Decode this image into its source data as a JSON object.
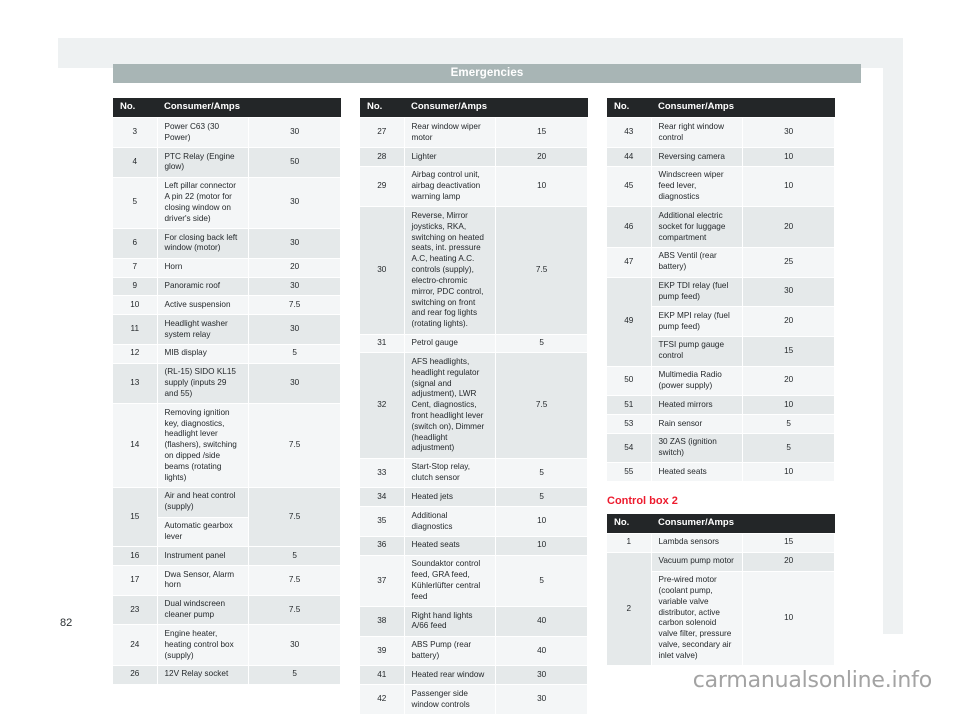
{
  "page": {
    "header_title": "Emergencies",
    "page_number": "82",
    "watermark": "carmanualsonline.info"
  },
  "table_headers": {
    "no": "No.",
    "consumer": "Consumer/Amps"
  },
  "sections": [
    {
      "id": "control-box-1-col-1",
      "heading": null,
      "rows": [
        {
          "no": "3",
          "lines": [
            {
              "desc": "Power C63 (30 Power)",
              "amp": "30"
            }
          ]
        },
        {
          "no": "4",
          "lines": [
            {
              "desc": "PTC Relay (Engine glow)",
              "amp": "50"
            }
          ]
        },
        {
          "no": "5",
          "lines": [
            {
              "desc": "Left pillar connector A pin 22 (motor for closing window on driver's side)",
              "amp": "30"
            }
          ]
        },
        {
          "no": "6",
          "lines": [
            {
              "desc": "For closing back left window (motor)",
              "amp": "30"
            }
          ]
        },
        {
          "no": "7",
          "lines": [
            {
              "desc": "Horn",
              "amp": "20"
            }
          ]
        },
        {
          "no": "9",
          "lines": [
            {
              "desc": "Panoramic roof",
              "amp": "30"
            }
          ]
        },
        {
          "no": "10",
          "lines": [
            {
              "desc": "Active suspension",
              "amp": "7.5"
            }
          ]
        },
        {
          "no": "11",
          "lines": [
            {
              "desc": "Headlight washer system relay",
              "amp": "30"
            }
          ]
        },
        {
          "no": "12",
          "lines": [
            {
              "desc": "MIB display",
              "amp": "5"
            }
          ]
        },
        {
          "no": "13",
          "lines": [
            {
              "desc": "(RL-15) SIDO KL15 supply (inputs 29 and 55)",
              "amp": "30"
            }
          ]
        },
        {
          "no": "14",
          "lines": [
            {
              "desc": "Removing ignition key, diagnostics, headlight lever (flashers), switching on dipped /side beams (rotating lights)",
              "amp": "7.5"
            }
          ]
        },
        {
          "no": "15",
          "merged_amp": "7.5",
          "lines": [
            {
              "desc": "Air and heat control (supply)"
            },
            {
              "desc": "Automatic gearbox lever"
            }
          ]
        },
        {
          "no": "16",
          "lines": [
            {
              "desc": "Instrument panel",
              "amp": "5"
            }
          ]
        },
        {
          "no": "17",
          "lines": [
            {
              "desc": "Dwa Sensor, Alarm horn",
              "amp": "7.5"
            }
          ]
        },
        {
          "no": "23",
          "lines": [
            {
              "desc": "Dual windscreen cleaner pump",
              "amp": "7.5"
            }
          ]
        },
        {
          "no": "24",
          "lines": [
            {
              "desc": "Engine heater, heating control box (supply)",
              "amp": "30"
            }
          ]
        },
        {
          "no": "26",
          "lines": [
            {
              "desc": "12V Relay socket",
              "amp": "5"
            }
          ]
        }
      ]
    },
    {
      "id": "control-box-1-col-2",
      "heading": null,
      "rows": [
        {
          "no": "27",
          "lines": [
            {
              "desc": "Rear window wiper motor",
              "amp": "15"
            }
          ]
        },
        {
          "no": "28",
          "lines": [
            {
              "desc": "Lighter",
              "amp": "20"
            }
          ]
        },
        {
          "no": "29",
          "lines": [
            {
              "desc": "Airbag control unit, airbag deactivation warning lamp",
              "amp": "10"
            }
          ]
        },
        {
          "no": "30",
          "lines": [
            {
              "desc": "Reverse, Mirror joysticks, RKA, switching on heated seats, int. pressure A.C, heating A.C. controls (supply), electro-chromic mirror, PDC control, switching on front and rear fog lights (rotating lights).",
              "amp": "7.5"
            }
          ]
        },
        {
          "no": "31",
          "lines": [
            {
              "desc": "Petrol gauge",
              "amp": "5"
            }
          ]
        },
        {
          "no": "32",
          "lines": [
            {
              "desc": "AFS headlights, headlight regulator (signal and adjustment), LWR Cent, diagnostics, front headlight lever (switch on), Dimmer (headlight adjustment)",
              "amp": "7.5"
            }
          ]
        },
        {
          "no": "33",
          "lines": [
            {
              "desc": "Start-Stop relay, clutch sensor",
              "amp": "5"
            }
          ]
        },
        {
          "no": "34",
          "lines": [
            {
              "desc": "Heated jets",
              "amp": "5"
            }
          ]
        },
        {
          "no": "35",
          "lines": [
            {
              "desc": "Additional diagnostics",
              "amp": "10"
            }
          ]
        },
        {
          "no": "36",
          "lines": [
            {
              "desc": "Heated seats",
              "amp": "10"
            }
          ]
        },
        {
          "no": "37",
          "lines": [
            {
              "desc": "Soundaktor control feed, GRA feed, Kühlerlüfter central feed",
              "amp": "5"
            }
          ]
        },
        {
          "no": "38",
          "lines": [
            {
              "desc": "Right hand lights A/66 feed",
              "amp": "40"
            }
          ]
        },
        {
          "no": "39",
          "lines": [
            {
              "desc": "ABS Pump (rear battery)",
              "amp": "40"
            }
          ]
        },
        {
          "no": "41",
          "lines": [
            {
              "desc": "Heated rear window",
              "amp": "30"
            }
          ]
        },
        {
          "no": "42",
          "lines": [
            {
              "desc": "Passenger side window controls",
              "amp": "30"
            }
          ]
        }
      ]
    },
    {
      "id": "control-box-1-col-3",
      "heading": null,
      "rows": [
        {
          "no": "43",
          "lines": [
            {
              "desc": "Rear right window control",
              "amp": "30"
            }
          ]
        },
        {
          "no": "44",
          "lines": [
            {
              "desc": "Reversing camera",
              "amp": "10"
            }
          ]
        },
        {
          "no": "45",
          "lines": [
            {
              "desc": "Windscreen wiper feed lever, diagnostics",
              "amp": "10"
            }
          ]
        },
        {
          "no": "46",
          "lines": [
            {
              "desc": "Additional electric socket for luggage compartment",
              "amp": "20"
            }
          ]
        },
        {
          "no": "47",
          "lines": [
            {
              "desc": "ABS Ventil (rear battery)",
              "amp": "25"
            }
          ]
        },
        {
          "no": "49",
          "lines": [
            {
              "desc": "EKP TDI relay (fuel pump feed)",
              "amp": "30"
            },
            {
              "desc": "EKP MPI relay (fuel pump feed)",
              "amp": "20"
            },
            {
              "desc": "TFSI pump gauge control",
              "amp": "15"
            }
          ]
        },
        {
          "no": "50",
          "lines": [
            {
              "desc": "Multimedia Radio (power supply)",
              "amp": "20"
            }
          ]
        },
        {
          "no": "51",
          "lines": [
            {
              "desc": "Heated mirrors",
              "amp": "10"
            }
          ]
        },
        {
          "no": "53",
          "lines": [
            {
              "desc": "Rain sensor",
              "amp": "5"
            }
          ]
        },
        {
          "no": "54",
          "lines": [
            {
              "desc": "30 ZAS (ignition switch)",
              "amp": "5"
            }
          ]
        },
        {
          "no": "55",
          "lines": [
            {
              "desc": "Heated seats",
              "amp": "10"
            }
          ]
        }
      ]
    },
    {
      "id": "control-box-2",
      "heading": "Control box 2",
      "rows": [
        {
          "no": "1",
          "lines": [
            {
              "desc": "Lambda sensors",
              "amp": "15"
            }
          ]
        },
        {
          "no": "2",
          "lines": [
            {
              "desc": "Vacuum pump motor",
              "amp": "20"
            },
            {
              "desc": "Pre-wired motor (coolant pump, variable valve distributor, active carbon solenoid valve filter, pressure valve, secondary air inlet valve)",
              "amp": "10"
            }
          ]
        }
      ]
    }
  ],
  "colors": {
    "header_bar": "#a8b5b5",
    "table_header": "#232628",
    "row_light": "#f4f6f7",
    "row_dark": "#e5e9ea",
    "accent_red": "#ed1b2e"
  }
}
